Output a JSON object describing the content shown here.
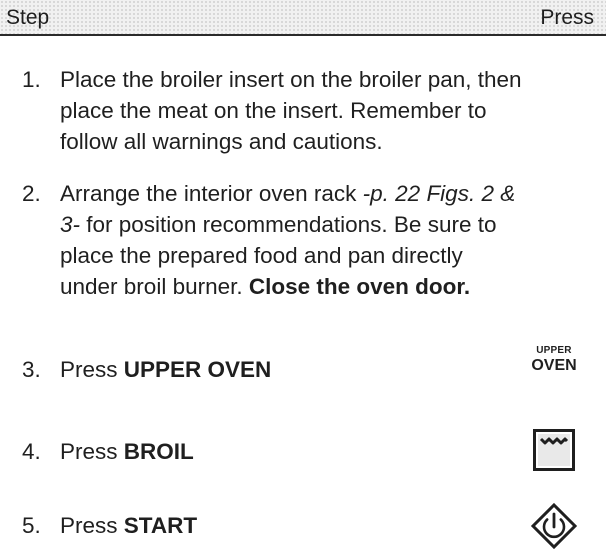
{
  "header": {
    "step_label": "Step",
    "press_label": "Press"
  },
  "steps": [
    {
      "number": "1.",
      "lines": [
        "Place the broiler insert on the broiler pan, then",
        "place the meat on the insert. Remember to",
        "follow all warnings and cautions."
      ]
    },
    {
      "number": "2.",
      "line1_a": "Arrange the interior oven rack ",
      "line1_ref": "-p. 22 Figs. 2 &",
      "line2_ref": "3-",
      "line2_b": " for position recommendations. Be sure to",
      "line3": "place the prepared food and pan directly",
      "line4_a": "under broil burner. ",
      "line4_bold": "Close the oven door."
    },
    {
      "number": "3.",
      "prefix": "Press ",
      "key": "UPPER OVEN"
    },
    {
      "number": "4.",
      "prefix": "Press ",
      "key": "BROIL"
    },
    {
      "number": "5.",
      "prefix": "Press ",
      "key": "START"
    }
  ],
  "press_keys": {
    "upper_oven_small": "UPPER",
    "upper_oven_big": "OVEN",
    "broil_icon": "broil-pad-icon",
    "start_icon": "start-pad-icon"
  }
}
